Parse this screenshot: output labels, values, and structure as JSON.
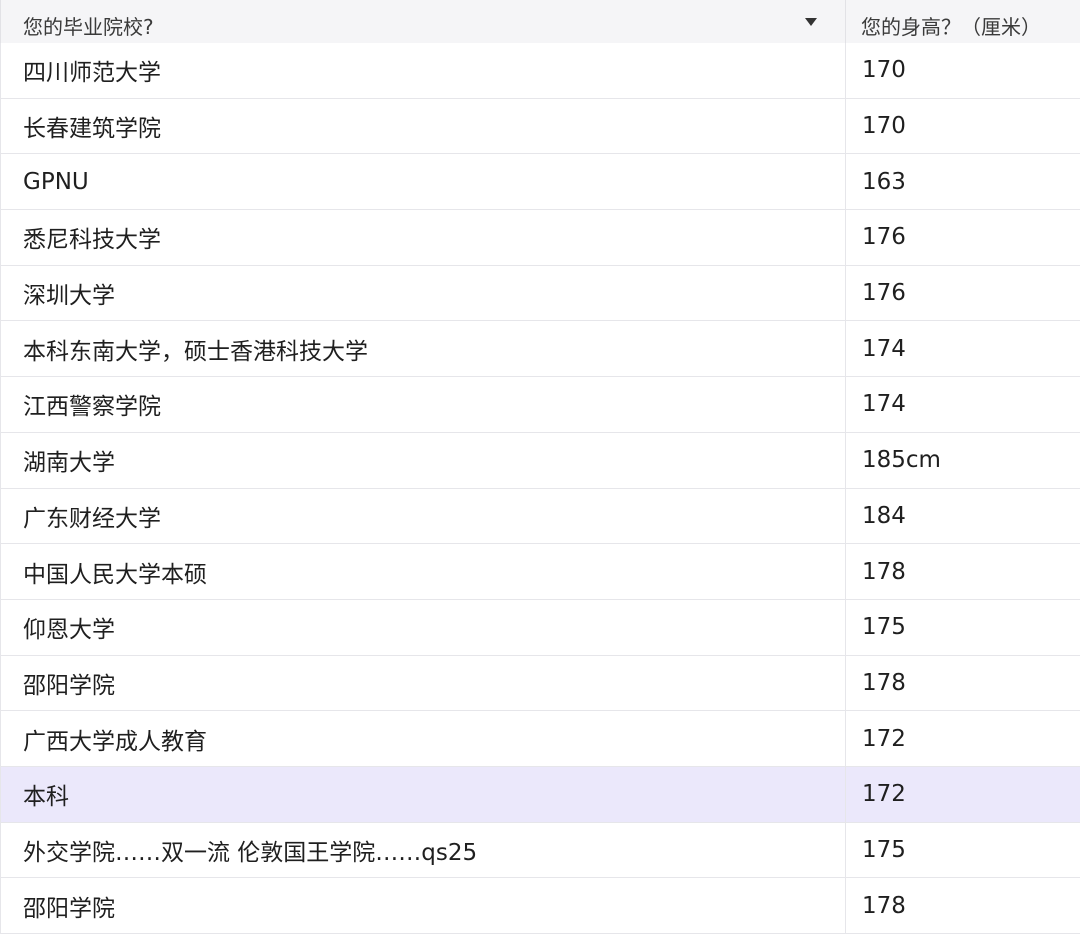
{
  "header": {
    "col_school": "您的毕业院校?",
    "col_height": "您的身高？（厘米）"
  },
  "rows": [
    {
      "school": "四川师范大学",
      "height": "170",
      "selected": false
    },
    {
      "school": "长春建筑学院",
      "height": "170",
      "selected": false
    },
    {
      "school": "GPNU",
      "height": "163",
      "selected": false
    },
    {
      "school": "悉尼科技大学",
      "height": "176",
      "selected": false
    },
    {
      "school": "深圳大学",
      "height": "176",
      "selected": false
    },
    {
      "school": "本科东南大学，硕士香港科技大学",
      "height": "174",
      "selected": false
    },
    {
      "school": "江西警察学院",
      "height": "174",
      "selected": false
    },
    {
      "school": "湖南大学",
      "height": "185cm",
      "selected": false
    },
    {
      "school": "广东财经大学",
      "height": "184",
      "selected": false
    },
    {
      "school": "中国人民大学本硕",
      "height": "178",
      "selected": false
    },
    {
      "school": "仰恩大学",
      "height": "175",
      "selected": false
    },
    {
      "school": "邵阳学院",
      "height": "178",
      "selected": false
    },
    {
      "school": "广西大学成人教育",
      "height": "172",
      "selected": false
    },
    {
      "school": "本科",
      "height": "172",
      "selected": true
    },
    {
      "school": "外交学院……双一流 伦敦国王学院……qs25",
      "height": "175",
      "selected": false
    },
    {
      "school": "邵阳学院",
      "height": "178",
      "selected": false
    }
  ]
}
